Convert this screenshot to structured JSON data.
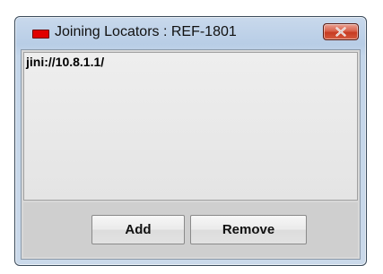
{
  "window": {
    "title": "Joining Locators : REF-1801",
    "close_icon": "close-icon"
  },
  "locators": {
    "items": [
      "jini://10.8.1.1/"
    ]
  },
  "buttons": {
    "add_label": "Add",
    "remove_label": "Remove"
  },
  "colors": {
    "app_icon": "#e00000",
    "close_button": "#c73b22",
    "titlebar": "#c4d6ea"
  }
}
